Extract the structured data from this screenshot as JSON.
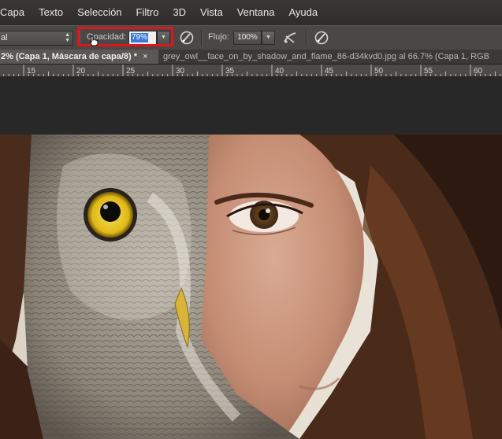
{
  "menubar": {
    "items": [
      "Capa",
      "Texto",
      "Selección",
      "Filtro",
      "3D",
      "Vista",
      "Ventana",
      "Ayuda"
    ]
  },
  "options": {
    "blend_mode": "al",
    "opacity_label": "Opacidad:",
    "opacity_value": "79%",
    "flow_label": "Flujo:",
    "flow_value": "100%"
  },
  "tabs": {
    "active_label": "2% (Capa 1, Máscara de capa/8) *",
    "inactive_label": "grey_owl__face_on_by_shadow_and_flame_86-d34kvd0.jpg al 66.7% (Capa 1, RGB"
  },
  "ruler": {
    "labels": [
      "15",
      "20",
      "25",
      "30",
      "35",
      "40",
      "45",
      "50",
      "55",
      "60"
    ]
  },
  "colors": {
    "highlight": "#e0141b",
    "selection": "#3c78d8"
  }
}
